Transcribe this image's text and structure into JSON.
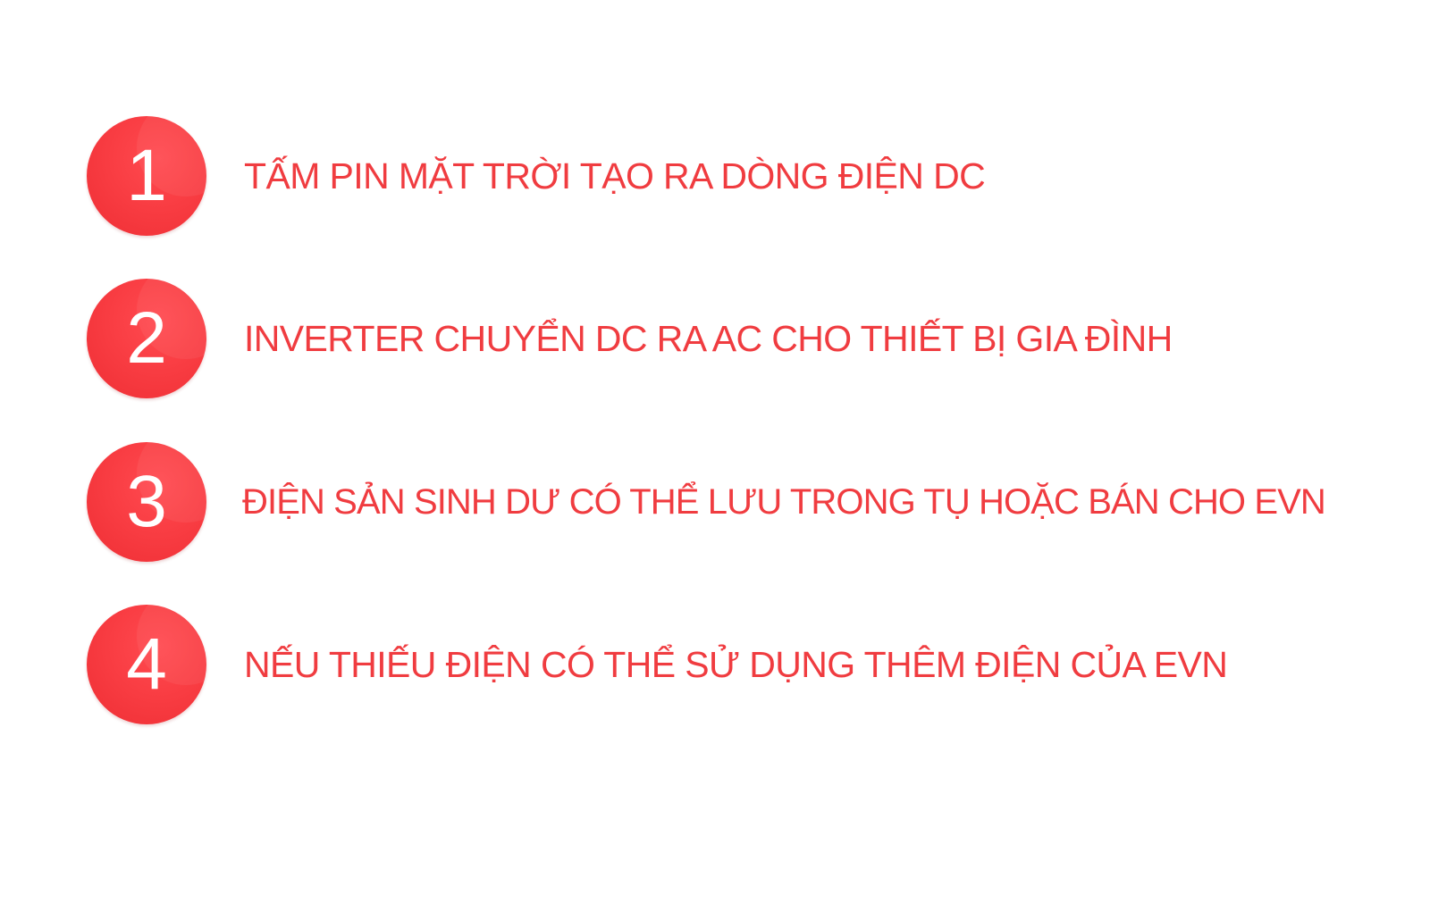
{
  "steps": [
    {
      "number": "1",
      "text": "TẤM PIN MẶT TRỜI TẠO RA DÒNG ĐIỆN DC"
    },
    {
      "number": "2",
      "text": "INVERTER CHUYỂN DC RA AC CHO THIẾT BỊ GIA ĐÌNH"
    },
    {
      "number": "3",
      "text": "ĐIỆN SẢN SINH DƯ CÓ THỂ LƯU TRONG TỤ HOẶC BÁN CHO EVN"
    },
    {
      "number": "4",
      "text": "NẾU THIẾU ĐIỆN CÓ THỂ SỬ DỤNG THÊM ĐIỆN CỦA EVN"
    }
  ],
  "colors": {
    "accent": "#f03c40",
    "badge_text": "#ffffff",
    "background": "#ffffff"
  }
}
